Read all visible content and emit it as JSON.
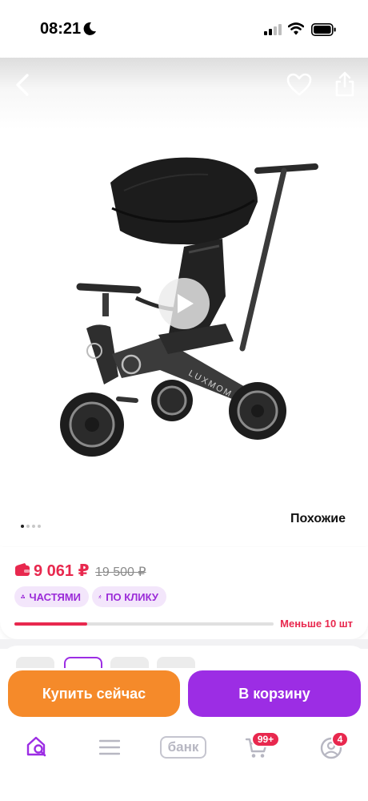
{
  "status_bar": {
    "time": "08:21"
  },
  "product": {
    "brand_on_image": "LUXMOM",
    "similar_label": "Похожие",
    "gallery_dots": 4,
    "gallery_active_index": 0
  },
  "price": {
    "current": "9 061 ₽",
    "old": "19 500 ₽",
    "chips": [
      {
        "label": "ЧАСТЯМИ",
        "icon": "installments-icon"
      },
      {
        "label": "ПО КЛИКУ",
        "icon": "runner-icon"
      }
    ],
    "stock_text": "Меньше 10 шт",
    "stock_level_fraction": 0.28
  },
  "actions": {
    "buy_now": "Купить сейчас",
    "add_to_cart": "В корзину"
  },
  "bottom_nav": {
    "bank_label": "банк",
    "cart_badge": "99+",
    "profile_badge": "4"
  },
  "colors": {
    "accent_purple": "#9c2de4",
    "accent_orange": "#f58a2a",
    "price_red": "#e8284e"
  }
}
